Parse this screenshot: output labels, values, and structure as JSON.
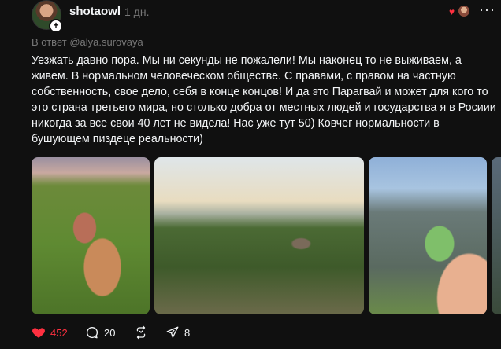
{
  "post": {
    "username": "shotaowl",
    "time": "1 дн.",
    "reply_prefix": "В ответ ",
    "reply_handle": "@alya.surovaya",
    "text": "Уезжать давно пора. Мы ни секунды не пожалели! Мы наконец то не выживаем, а живем. В нормальном человеческом обществе. С правами, с правом на частную собственность, свое дело, себя в конце концов! И да это Парагвай и может для кого то это страна третьего мира, но столько добра от местных людей и государства я в Росиии никогда за все свои 40 лет не видела! Нас уже тут 50) Ковчег нормальности в бушующем пиздеце реальности)",
    "more_label": "···",
    "avatar_plus": "+"
  },
  "media": [
    {
      "icon": "photo-selfie-parrot"
    },
    {
      "icon": "photo-couple-viewpoint"
    },
    {
      "icon": "photo-parrot-on-hand"
    },
    {
      "icon": "photo-partial"
    }
  ],
  "actions": {
    "likes": "452",
    "replies": "20",
    "shares": "8",
    "like_color": "#ff3040"
  },
  "icons": {
    "like": "heart-icon",
    "reply": "comment-icon",
    "repost": "repost-icon",
    "share": "send-icon",
    "more": "more-icon"
  }
}
